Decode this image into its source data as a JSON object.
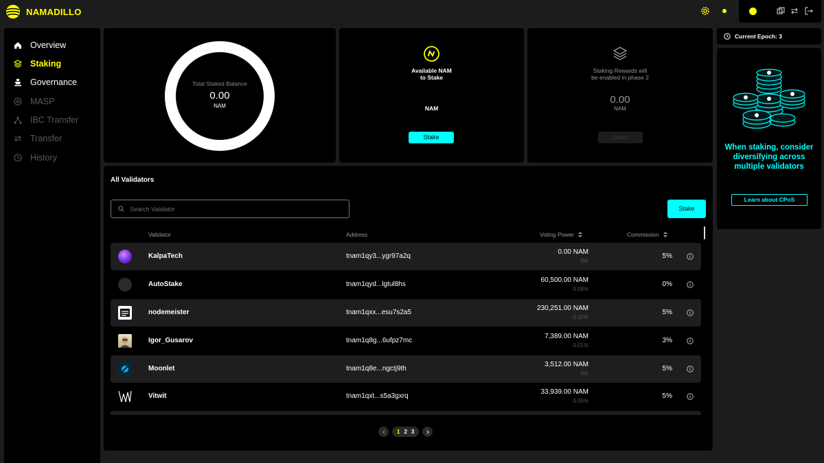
{
  "app": {
    "brand": "NAMADILLO"
  },
  "nav": {
    "items": [
      {
        "label": "Overview",
        "state": "normal",
        "icon": "home-icon"
      },
      {
        "label": "Staking",
        "state": "active",
        "icon": "layers-icon"
      },
      {
        "label": "Governance",
        "state": "normal",
        "icon": "governance-icon"
      },
      {
        "label": "MASP",
        "state": "disabled",
        "icon": "masp-icon"
      },
      {
        "label": "IBC Transfer",
        "state": "disabled",
        "icon": "ibc-icon"
      },
      {
        "label": "Transfer",
        "state": "disabled",
        "icon": "transfer-icon"
      },
      {
        "label": "History",
        "state": "disabled",
        "icon": "history-icon"
      }
    ]
  },
  "balance": {
    "label": "Total Staked Balance",
    "value": "0.00",
    "unit": "NAM"
  },
  "available": {
    "line1": "Available NAM",
    "line2": "to Stake",
    "unit": "NAM",
    "button": "Stake"
  },
  "rewards": {
    "line1": "Staking Rewards will",
    "line2": "be enabled in phase 2",
    "value": "0.00",
    "unit": "NAM",
    "button": "Claim"
  },
  "validators": {
    "title": "All Validators",
    "search_placeholder": "Search Validator",
    "stake_button": "Stake",
    "columns": {
      "validator": "Validator",
      "address": "Address",
      "voting_power": "Voting Power",
      "commission": "Commission"
    },
    "rows": [
      {
        "name": "KalpaTech",
        "address": "tnam1qy3...ygr97a2q",
        "voting_power": "0.00 NAM",
        "vp_percent": "0%",
        "commission": "5%"
      },
      {
        "name": "AutoStake",
        "address": "tnam1qyd...lgtul8hs",
        "voting_power": "60,500.00 NAM",
        "vp_percent": "0.08%",
        "commission": "0%"
      },
      {
        "name": "nodemeister",
        "address": "tnam1qxx...esu7s2a5",
        "voting_power": "230,251.00 NAM",
        "vp_percent": "0.32%",
        "commission": "5%"
      },
      {
        "name": "Igor_Gusarov",
        "address": "tnam1q8g...6ufpz7mc",
        "voting_power": "7,389.00 NAM",
        "vp_percent": "0.01%",
        "commission": "3%"
      },
      {
        "name": "Moonlet",
        "address": "tnam1q8e...ngctj9th",
        "voting_power": "3,512.00 NAM",
        "vp_percent": "0%",
        "commission": "5%"
      },
      {
        "name": "Vitwit",
        "address": "tnam1qxt...s5a3gxrq",
        "voting_power": "33,939.00 NAM",
        "vp_percent": "0.05%",
        "commission": "5%"
      }
    ],
    "pages": [
      "1",
      "2",
      "3"
    ]
  },
  "epoch": {
    "label": "Current Epoch: 3"
  },
  "promo": {
    "text": "When staking, consider diversifying across multiple validators",
    "button": "Learn about CPoS"
  },
  "colors": {
    "accent_yellow": "#ffff00",
    "accent_cyan": "#00ffff",
    "panel_bg": "#000000",
    "page_bg": "#1c1c1c"
  }
}
